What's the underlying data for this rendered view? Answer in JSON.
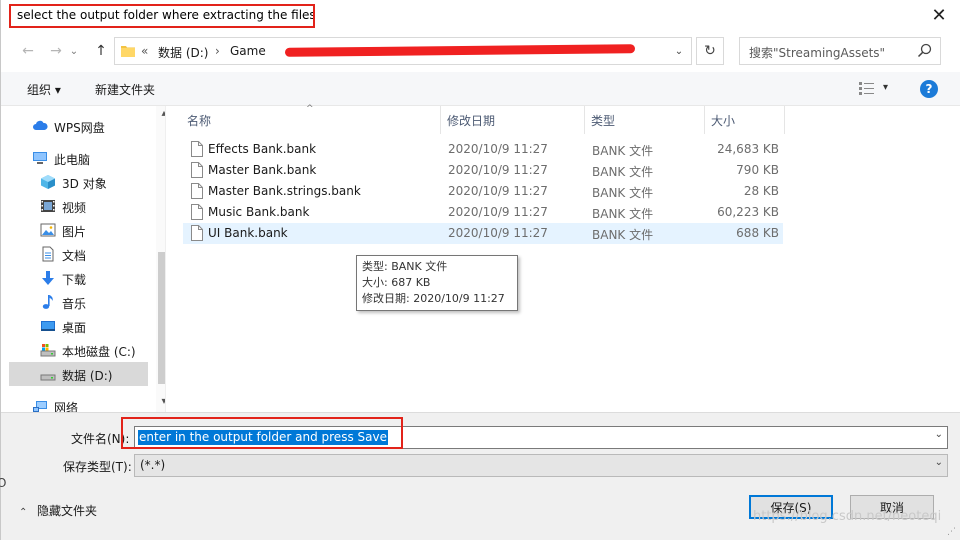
{
  "title": "select the output folder where extracting the files",
  "close_glyph": "✕",
  "nav": {
    "back_glyph": "←",
    "forward_glyph": "→",
    "dropdown_glyph": "⌄",
    "up_glyph": "↑",
    "address": {
      "chevron": "«",
      "crumbs": [
        "数据 (D:)",
        "Game"
      ],
      "separator": "›",
      "redacted": true
    },
    "address_dropdown_glyph": "⌄",
    "refresh_glyph": "↻",
    "search_placeholder": "搜索\"StreamingAssets\""
  },
  "toolbar": {
    "organize": "组织 ▾",
    "new_folder": "新建文件夹",
    "view_dropdown": "▾",
    "help": "?"
  },
  "sidebar": {
    "items": [
      {
        "label": "WPS网盘",
        "icon": "cloud-icon"
      },
      {
        "label": "此电脑",
        "icon": "computer-icon"
      },
      {
        "label": "3D 对象",
        "icon": "cube-icon"
      },
      {
        "label": "视频",
        "icon": "video-icon"
      },
      {
        "label": "图片",
        "icon": "picture-icon"
      },
      {
        "label": "文档",
        "icon": "document-icon"
      },
      {
        "label": "下载",
        "icon": "download-icon"
      },
      {
        "label": "音乐",
        "icon": "music-icon"
      },
      {
        "label": "桌面",
        "icon": "desktop-icon"
      },
      {
        "label": "本地磁盘 (C:)",
        "icon": "drive-c-icon"
      },
      {
        "label": "数据 (D:)",
        "icon": "drive-d-icon",
        "selected": true
      },
      {
        "label": "网络",
        "icon": "network-icon"
      }
    ],
    "scroll_up": "▴",
    "scroll_down": "▾"
  },
  "filelist": {
    "sort_indicator": "^",
    "columns": [
      "名称",
      "修改日期",
      "类型",
      "大小"
    ],
    "rows": [
      {
        "name": "Effects Bank.bank",
        "date": "2020/10/9 11:27",
        "type": "BANK 文件",
        "size": "24,683 KB"
      },
      {
        "name": "Master Bank.bank",
        "date": "2020/10/9 11:27",
        "type": "BANK 文件",
        "size": "790 KB"
      },
      {
        "name": "Master Bank.strings.bank",
        "date": "2020/10/9 11:27",
        "type": "BANK 文件",
        "size": "28 KB"
      },
      {
        "name": "Music Bank.bank",
        "date": "2020/10/9 11:27",
        "type": "BANK 文件",
        "size": "60,223 KB"
      },
      {
        "name": "UI Bank.bank",
        "date": "2020/10/9 11:27",
        "type": "BANK 文件",
        "size": "688 KB",
        "hover": true
      }
    ],
    "tooltip": [
      "类型: BANK 文件",
      "大小: 687 KB",
      "修改日期: 2020/10/9 11:27"
    ]
  },
  "form": {
    "filename_label": "文件名(N):",
    "filename_value": "enter in the output folder and press Save",
    "filetype_label": "保存类型(T):",
    "filetype_value": "(*.*)",
    "dropdown_glyph": "⌄",
    "hide_folders_chevron": "⌃",
    "hide_folders": "隐藏文件夹",
    "save_button": "保存(S)",
    "cancel_button": "取消"
  },
  "watermark": "https://blog.csdn.net/neoteqi",
  "grip_glyph": "⋰",
  "edge_glyph": "O",
  "colors": {
    "accent": "#0078d7",
    "annotation_red": "#e2231a",
    "selection_light": "#cce4f7",
    "hover_row": "#e5f3ff"
  }
}
